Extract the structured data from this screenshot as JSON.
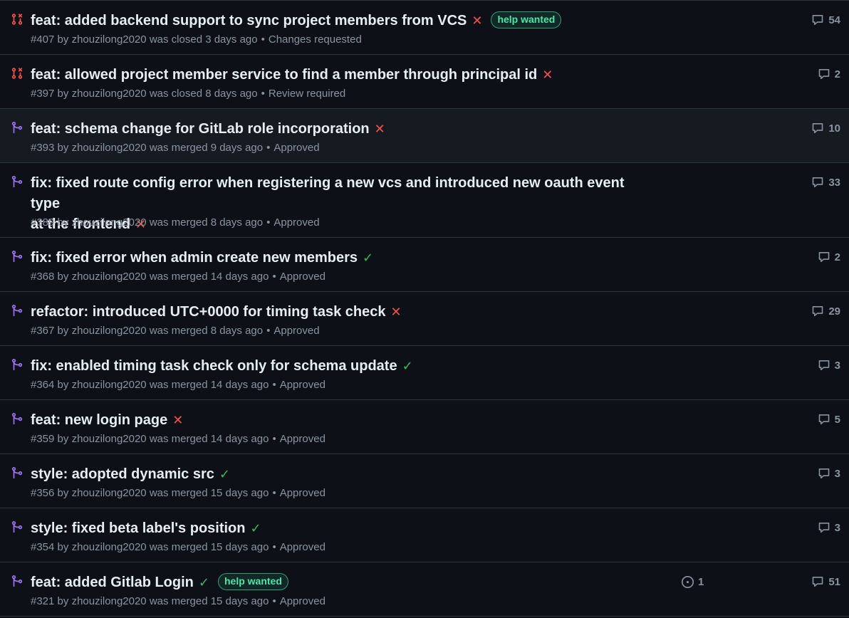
{
  "colors": {
    "background": "#0d1117",
    "row_highlight": "#161b22",
    "border": "#30363d",
    "closed": "#f85149",
    "merged": "#a371f7",
    "success": "#3fb950",
    "fail": "#f85149",
    "label_green": "#4ee6a8",
    "muted": "#8b949e"
  },
  "icons": {
    "closed_pr": "git-pull-request-closed-icon",
    "merged_pr": "git-merge-icon",
    "fail": "x-icon",
    "success": "check-icon",
    "comment": "comment-icon",
    "issue": "issue-opened-icon"
  },
  "pull_requests": [
    {
      "state": "closed",
      "title": "feat: added backend support to sync project members from VCS",
      "status": "failure",
      "label": "help wanted",
      "number": "#407",
      "author": "zhouzilong2020",
      "action": "was closed",
      "time": "3 days ago",
      "review": "Changes requested",
      "comments": "54"
    },
    {
      "state": "closed",
      "title": "feat: allowed project member service to find a member through principal id",
      "status": "failure",
      "number": "#397",
      "author": "zhouzilong2020",
      "action": "was closed",
      "time": "8 days ago",
      "review": "Review required",
      "comments": "2"
    },
    {
      "state": "merged",
      "title": "feat: schema change for GitLab role incorporation",
      "status": "failure",
      "number": "#393",
      "author": "zhouzilong2020",
      "action": "was merged",
      "time": "9 days ago",
      "review": "Approved",
      "comments": "10"
    },
    {
      "state": "merged",
      "title_line1": "fix: fixed route config error when registering a new vcs and introduced new oauth event type",
      "title_line2": "at the frontend",
      "status": "failure",
      "number": "#389",
      "author": "zhouzilong2020",
      "action": "was merged",
      "time": "8 days ago",
      "review": "Approved",
      "comments": "33"
    },
    {
      "state": "merged",
      "title": "fix: fixed error when admin create new members",
      "status": "success",
      "number": "#368",
      "author": "zhouzilong2020",
      "action": "was merged",
      "time": "14 days ago",
      "review": "Approved",
      "comments": "2"
    },
    {
      "state": "merged",
      "title": "refactor: introduced UTC+0000 for timing task check",
      "status": "failure",
      "number": "#367",
      "author": "zhouzilong2020",
      "action": "was merged",
      "time": "8 days ago",
      "review": "Approved",
      "comments": "29"
    },
    {
      "state": "merged",
      "title": "fix: enabled timing task check only for schema update",
      "status": "success",
      "number": "#364",
      "author": "zhouzilong2020",
      "action": "was merged",
      "time": "14 days ago",
      "review": "Approved",
      "comments": "3"
    },
    {
      "state": "merged",
      "title": "feat: new login page",
      "status": "failure",
      "number": "#359",
      "author": "zhouzilong2020",
      "action": "was merged",
      "time": "14 days ago",
      "review": "Approved",
      "comments": "5"
    },
    {
      "state": "merged",
      "title": "style: adopted dynamic src",
      "status": "success",
      "number": "#356",
      "author": "zhouzilong2020",
      "action": "was merged",
      "time": "15 days ago",
      "review": "Approved",
      "comments": "3"
    },
    {
      "state": "merged",
      "title": "style: fixed beta label's position",
      "status": "success",
      "number": "#354",
      "author": "zhouzilong2020",
      "action": "was merged",
      "time": "15 days ago",
      "review": "Approved",
      "comments": "3"
    },
    {
      "state": "merged",
      "title": "feat: added Gitlab Login",
      "status": "success",
      "label": "help wanted",
      "linked_issues": "1",
      "number": "#321",
      "author": "zhouzilong2020",
      "action": "was merged",
      "time": "15 days ago",
      "review": "Approved",
      "comments": "51"
    }
  ]
}
